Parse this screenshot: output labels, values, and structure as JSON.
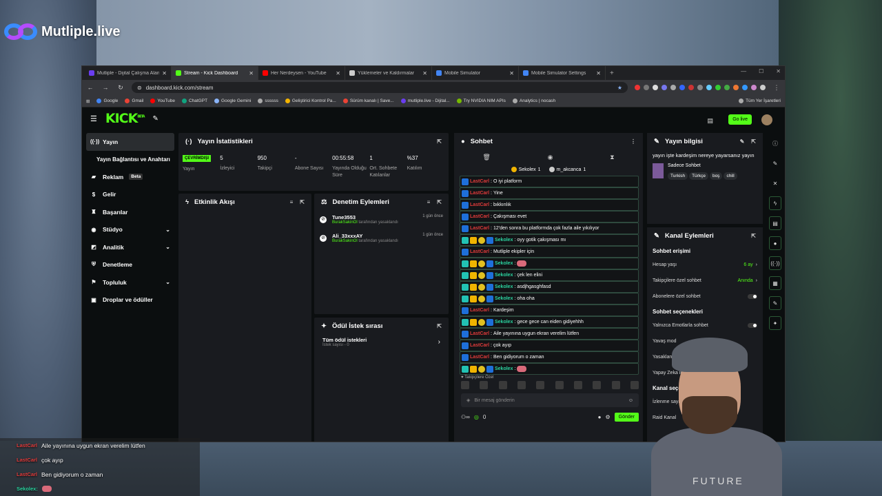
{
  "overlay_logo": "Mutliple.live",
  "browser": {
    "tabs": [
      {
        "label": "Mutliple - Dijital Çalışma Alanın",
        "color": "#6a3df0",
        "active": false
      },
      {
        "label": "Stream - Kick Dashboard",
        "color": "#53fc18",
        "active": true
      },
      {
        "label": "Her Nerdeysen - YouTube",
        "color": "#ff0000",
        "active": false
      },
      {
        "label": "Yüklemeler ve Kaldırmalar",
        "color": "#cccccc",
        "active": false
      },
      {
        "label": "Mobile Simulator",
        "color": "#4285f4",
        "active": false
      },
      {
        "label": "Mobile Simulator Settings",
        "color": "#4285f4",
        "active": false
      }
    ],
    "url": "dashboard.kick.com/stream",
    "bookmarks": [
      {
        "label": "Google",
        "color": "#4285f4"
      },
      {
        "label": "Gmail",
        "color": "#ea4335"
      },
      {
        "label": "YouTube",
        "color": "#ff0000"
      },
      {
        "label": "ChatGPT",
        "color": "#10a37f"
      },
      {
        "label": "Google Gemini",
        "color": "#8ab4f8"
      },
      {
        "label": "ssssss",
        "color": "#aaaaaa"
      },
      {
        "label": "Geliştirici Kontrol Pa...",
        "color": "#f4b400"
      },
      {
        "label": "Sürüm kanalı | Save...",
        "color": "#ea4335"
      },
      {
        "label": "mutliple.live - Dijital...",
        "color": "#6a3df0"
      },
      {
        "label": "Try NVIDIA NIM APIs",
        "color": "#76b900"
      },
      {
        "label": "Analytics | nocash",
        "color": "#aaaaaa"
      }
    ],
    "bookmarks_right": "Tüm Yer İşaretleri"
  },
  "kick": {
    "logo": "KICK",
    "logo_sup": "BETA",
    "go_live": "Go live",
    "sidebar": [
      {
        "label": "Yayın",
        "icon": "broadcast-icon",
        "glyph": "((·))",
        "active": true,
        "sub": false,
        "chev": ""
      },
      {
        "label": "Yayın Bağlantısı ve Anahtarı",
        "icon": "",
        "glyph": "",
        "active": false,
        "sub": true,
        "chev": ""
      },
      {
        "label": "Reklam",
        "icon": "megaphone-icon",
        "glyph": "▰",
        "active": false,
        "sub": false,
        "chev": "",
        "badge": "Beta"
      },
      {
        "label": "Gelir",
        "icon": "money-icon",
        "glyph": "$",
        "active": false,
        "sub": false,
        "chev": ""
      },
      {
        "label": "Başarılar",
        "icon": "trophy-icon",
        "glyph": "♜",
        "active": false,
        "sub": false,
        "chev": ""
      },
      {
        "label": "Stüdyo",
        "icon": "studio-icon",
        "glyph": "◉",
        "active": false,
        "sub": false,
        "chev": "⌄"
      },
      {
        "label": "Analitik",
        "icon": "chart-icon",
        "glyph": "◩",
        "active": false,
        "sub": false,
        "chev": "⌄"
      },
      {
        "label": "Denetleme",
        "icon": "shield-icon",
        "glyph": "⛨",
        "active": false,
        "sub": false,
        "chev": ""
      },
      {
        "label": "Topluluk",
        "icon": "community-icon",
        "glyph": "⚑",
        "active": false,
        "sub": false,
        "chev": "⌄"
      },
      {
        "label": "Droplar ve ödüller",
        "icon": "gift-icon",
        "glyph": "▣",
        "active": false,
        "sub": false,
        "chev": ""
      }
    ],
    "stats": {
      "title": "Yayın İstatistikleri",
      "offline_badge": "ÇEVRİMDIŞI",
      "items": [
        {
          "value": "",
          "label": "Yayın"
        },
        {
          "value": "5",
          "label": "İzleyici"
        },
        {
          "value": "950",
          "label": "Takipçi"
        },
        {
          "value": "-",
          "label": "Abone Sayısı"
        },
        {
          "value": "00:55:58",
          "label": "Yayında Olduğu Süre"
        },
        {
          "value": "1",
          "label": "Ort. Sohbete Katılanlar"
        },
        {
          "value": "%37",
          "label": "Katılım"
        }
      ]
    },
    "activity": {
      "title": "Etkinlik Akışı"
    },
    "moderation": {
      "title": "Denetim Eylemleri",
      "rows": [
        {
          "name": "Tune3553",
          "by": "BurakSakinOl",
          "action": "tarafından yasaklandı",
          "time": "1 gün önce"
        },
        {
          "name": "Ali_33xxxAY",
          "by": "BurakSakinOl",
          "action": "tarafından yasaklandı",
          "time": "1 gün önce"
        }
      ]
    },
    "rewards": {
      "title": "Ödül İstek sırası",
      "item": "Tüm ödül istekleri",
      "count": "İstek sayısı - 0"
    },
    "chat": {
      "title": "Sohbet",
      "pinned": [
        {
          "name": "Sekolex",
          "count": "1",
          "color": "#f0b400"
        },
        {
          "name": "m_akcanca",
          "count": "1",
          "color": "#cccccc"
        }
      ],
      "messages": [
        {
          "user": "LastCarl",
          "type": "red",
          "text": "O iyi platform",
          "badges": 1,
          "emote": false
        },
        {
          "user": "LastCarl",
          "type": "red",
          "text": "Yine",
          "badges": 1,
          "emote": false
        },
        {
          "user": "LastCarl",
          "type": "red",
          "text": "bıkkınlık",
          "badges": 1,
          "emote": false
        },
        {
          "user": "LastCarl",
          "type": "red",
          "text": "Çakışması evet",
          "badges": 1,
          "emote": false
        },
        {
          "user": "LastCarl",
          "type": "red",
          "text": "12'den sonra bu platformda çok fazla aile yıkılıyor",
          "badges": 1,
          "emote": false
        },
        {
          "user": "Sekolex",
          "type": "grn",
          "text": "oyy gotik çakışması mı",
          "badges": 4,
          "emote": false
        },
        {
          "user": "LastCarl",
          "type": "red",
          "text": "Mutliple ekipler için",
          "badges": 1,
          "emote": false
        },
        {
          "user": "Sekolex",
          "type": "grn",
          "text": "",
          "badges": 4,
          "emote": true
        },
        {
          "user": "Sekolex",
          "type": "grn",
          "text": "çek len elini",
          "badges": 4,
          "emote": false
        },
        {
          "user": "Sekolex",
          "type": "grn",
          "text": "asdjhgasghfasd",
          "badges": 4,
          "emote": false
        },
        {
          "user": "Sekolex",
          "type": "grn",
          "text": "oha oha",
          "badges": 4,
          "emote": false
        },
        {
          "user": "LastCarl",
          "type": "red",
          "text": "Kardeşim",
          "badges": 1,
          "emote": false
        },
        {
          "user": "Sekolex",
          "type": "grn",
          "text": "gece gece can eiden gidiyehhh",
          "badges": 4,
          "emote": false
        },
        {
          "user": "LastCarl",
          "type": "red",
          "text": "Aile yayınına uygun ekran verelim lütfen",
          "badges": 1,
          "emote": false
        },
        {
          "user": "LastCarl",
          "type": "red",
          "text": "çok ayıp",
          "badges": 1,
          "emote": false
        },
        {
          "user": "LastCarl",
          "type": "red",
          "text": "Ben gidiyorum o zaman",
          "badges": 1,
          "emote": false
        },
        {
          "user": "Sekolex",
          "type": "grn",
          "text": "",
          "badges": 4,
          "emote": true
        }
      ],
      "subscribers_only": "Takipçilere Özel",
      "input_placeholder": "Bir mesaj gönderin",
      "viewer_count": "0",
      "send": "Gönder"
    },
    "info": {
      "title": "Yayın bilgisi",
      "stream_title": "yayın işte kardeşim nereye yayarsanız yayın",
      "category": "Sadece Sohbet",
      "tags": [
        "Turkish",
        "Türkçe",
        "boş",
        "chill"
      ],
      "channel_actions": "Kanal Eylemleri",
      "chat_access": "Sohbet erişimi",
      "account_age": {
        "label": "Hesap yaşı",
        "value": "6 ay"
      },
      "followers_only": {
        "label": "Takipçilere özel sohbet",
        "value": "Anında"
      },
      "subs_only": "Abonelere özel sohbet",
      "chat_options": "Sohbet seçenekleri",
      "emotes_only": "Yalnızca Emotlarla sohbet",
      "slow_mode": "Yavaş mod",
      "banned_words": "Yasaklanmış kelimele",
      "ai_chat": "Yapay Zeka ile Sohbet",
      "channel_options": "Kanal seçenekleri",
      "show_views": "İzlenme sayısını göster",
      "raid": "Raid Kanal"
    }
  },
  "overlay_chat": [
    {
      "user": "LastCarl",
      "type": "red",
      "text": "Aile yayınına uygun ekran verelim lütfen"
    },
    {
      "user": "LastCarl",
      "type": "red",
      "text": "çok ayıp"
    },
    {
      "user": "LastCarl",
      "type": "red",
      "text": "Ben gidiyorum o zaman"
    },
    {
      "user": "Sekolex:",
      "type": "grn",
      "text": ""
    }
  ],
  "cam_shirt": "FUTURE"
}
